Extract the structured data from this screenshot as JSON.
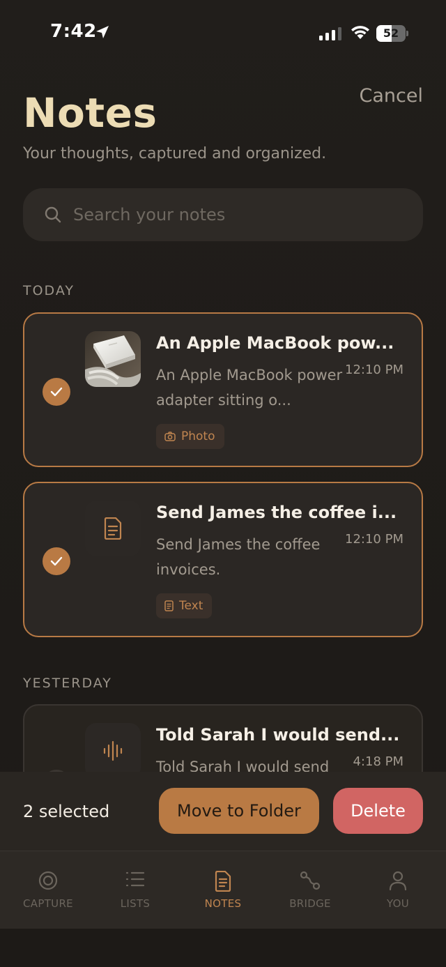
{
  "status_bar": {
    "time": "7:42",
    "battery": "52",
    "battery_level": 0.52
  },
  "header": {
    "cancel_label": "Cancel",
    "title": "Notes",
    "subtitle": "Your thoughts, captured and organized."
  },
  "search": {
    "placeholder": "Search your notes",
    "value": ""
  },
  "sections": {
    "today": "TODAY",
    "yesterday": "YESTERDAY"
  },
  "notes": [
    {
      "title": "An Apple MacBook pow...",
      "preview": "An Apple MacBook power adapter sitting o...",
      "time": "12:10 PM",
      "tag": "Photo",
      "tag_icon": "camera-icon",
      "selected": true
    },
    {
      "title": "Send James the coffee i...",
      "preview": "Send James the coffee invoices.",
      "time": "12:10 PM",
      "tag": "Text",
      "tag_icon": "document-icon",
      "selected": true
    },
    {
      "title": "Told Sarah I would send...",
      "preview": "Told Sarah I would send",
      "time": "4:18 PM",
      "tag_icon": "waveform-icon",
      "selected": false
    }
  ],
  "action_bar": {
    "selected_count": "2 selected",
    "move_label": "Move to Folder",
    "delete_label": "Delete"
  },
  "tabs": [
    {
      "label": "CAPTURE",
      "icon": "capture-icon"
    },
    {
      "label": "LISTS",
      "icon": "list-icon"
    },
    {
      "label": "NOTES",
      "icon": "notes-icon",
      "active": true
    },
    {
      "label": "BRIDGE",
      "icon": "bridge-icon"
    },
    {
      "label": "YOU",
      "icon": "person-icon"
    }
  ],
  "colors": {
    "accent": "#b97a44",
    "title": "#ecdcb4",
    "delete": "#d16563",
    "background": "#1f1c19"
  }
}
